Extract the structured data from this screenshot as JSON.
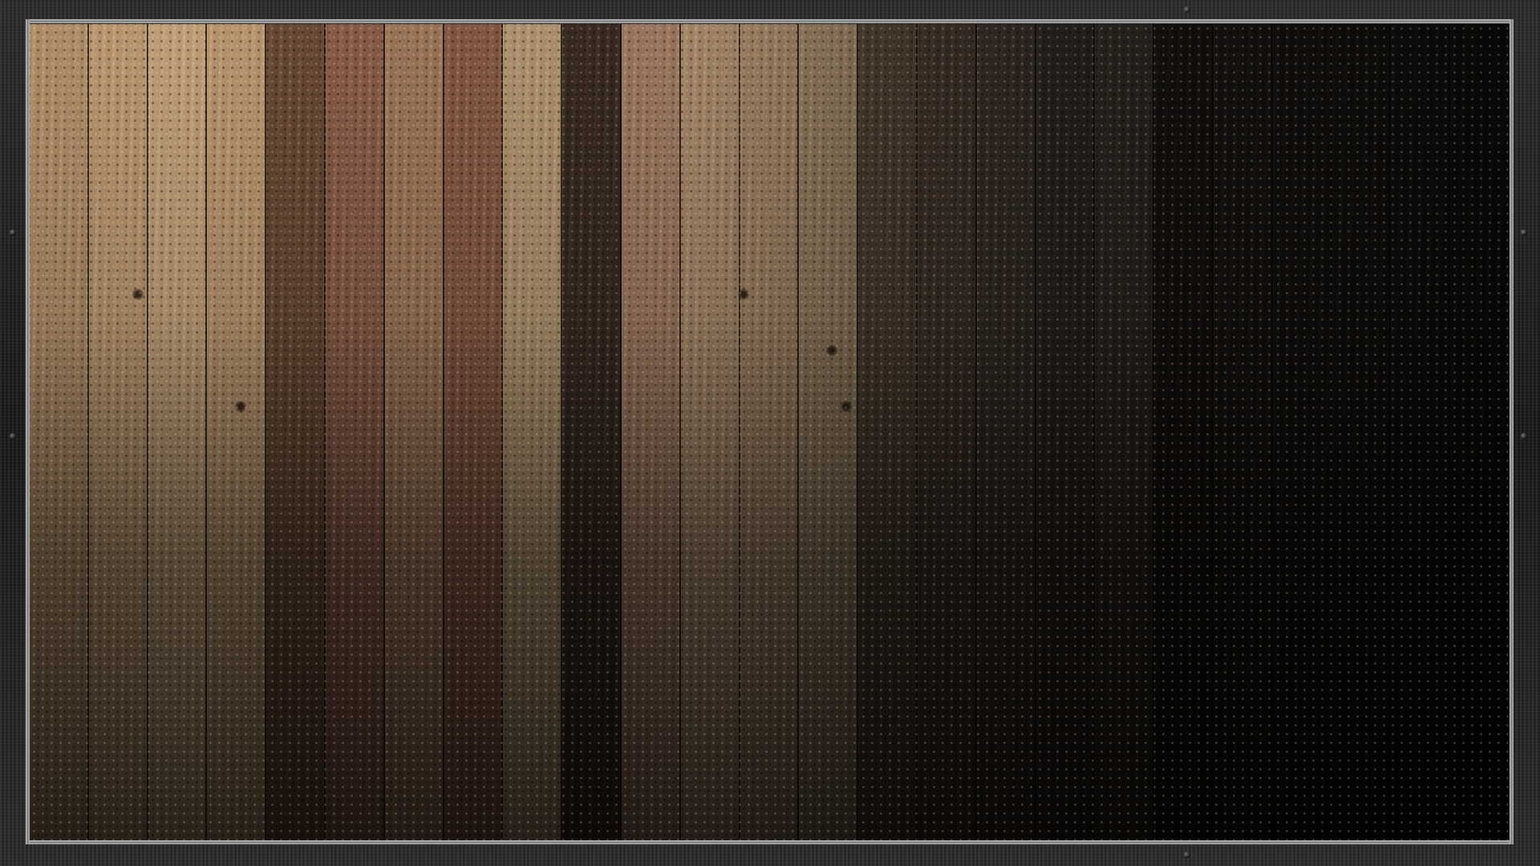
{
  "wallpaper": {
    "description_tag": "wood-plank-desktop-background",
    "planks": [
      {
        "tone": "#b5916a"
      },
      {
        "tone": "#c09b72"
      },
      {
        "tone": "#c7a47b"
      },
      {
        "tone": "#bf9a71"
      },
      {
        "tone": "#6b4b35"
      },
      {
        "tone": "#8e5f4a"
      },
      {
        "tone": "#a27a5b"
      },
      {
        "tone": "#8a5b45"
      },
      {
        "tone": "#b99a74"
      },
      {
        "tone": "#3b2c22"
      },
      {
        "tone": "#a57e64"
      },
      {
        "tone": "#b08f6e"
      },
      {
        "tone": "#ae8d6c"
      },
      {
        "tone": "#a58a6a"
      },
      {
        "tone": "#5a4838"
      },
      {
        "tone": "#4f4034"
      },
      {
        "tone": "#4a3e34"
      },
      {
        "tone": "#3f3630"
      },
      {
        "tone": "#4a4036"
      },
      {
        "tone": "#241f1b"
      },
      {
        "tone": "#2a2521"
      },
      {
        "tone": "#26221f"
      },
      {
        "tone": "#272320"
      },
      {
        "tone": "#252220"
      },
      {
        "tone": "#22201e"
      }
    ],
    "colors": {
      "frame": "#1f1f1f",
      "rail": "#a8a8a8",
      "light_wood": "#c7a47b",
      "dark_wood": "#241f1b"
    }
  }
}
